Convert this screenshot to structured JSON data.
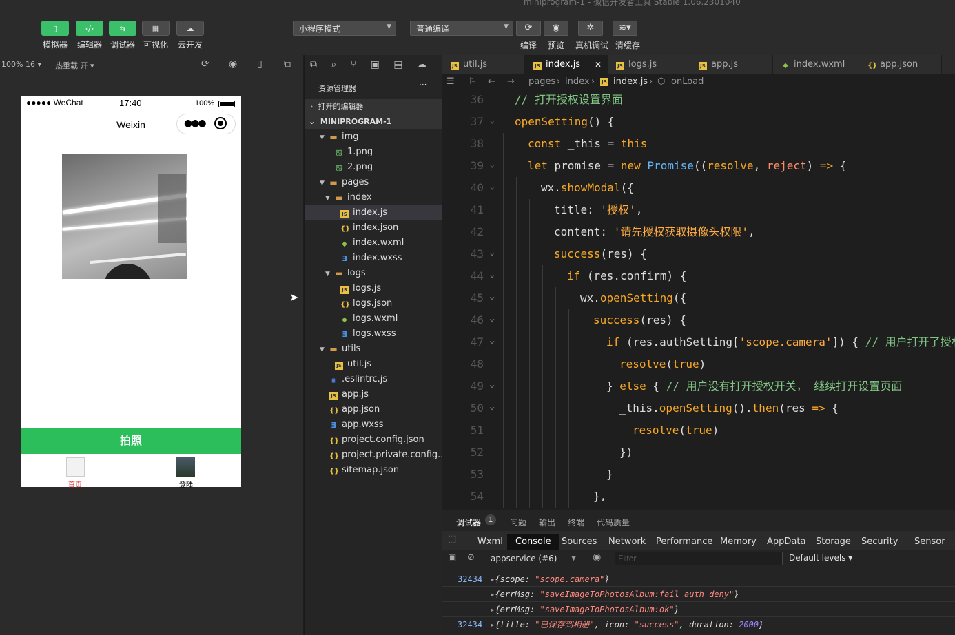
{
  "window": {
    "title": "miniprogram-1 - 微信开发者工具 Stable 1.06.2301040"
  },
  "toolbar": {
    "left_buttons": [
      {
        "label": "模拟器",
        "icon": "phone-icon"
      },
      {
        "label": "编辑器",
        "icon": "code-icon"
      },
      {
        "label": "调试器",
        "icon": "debug-icon"
      },
      {
        "label": "可视化",
        "icon": "layout-icon"
      },
      {
        "label": "云开发",
        "icon": "cloud-icon"
      }
    ],
    "mode_select": "小程序模式",
    "compile_select": "普通编译",
    "right_buttons": [
      {
        "label": "编译",
        "icon": "refresh-icon"
      },
      {
        "label": "预览",
        "icon": "eye-icon"
      },
      {
        "label": "真机调试",
        "icon": "bug-icon"
      },
      {
        "label": "清缓存",
        "icon": "layers-icon"
      }
    ]
  },
  "simulator": {
    "zoom": "100% 16",
    "hot_reload": "热重载 开",
    "status_carrier": "●●●●● WeChat",
    "status_time": "17:40",
    "status_battery": "100%",
    "nav_title": "Weixin",
    "photo_button": "拍照",
    "tabbar": [
      {
        "label": "首页",
        "active": true
      },
      {
        "label": "登陆",
        "active": false
      }
    ]
  },
  "explorer": {
    "title": "资源管理器",
    "more": "···",
    "open_editors": "打开的编辑器",
    "project": "MINIPROGRAM-1",
    "items": [
      {
        "name": "img",
        "type": "folder",
        "depth": 1,
        "open": true
      },
      {
        "name": "1.png",
        "type": "img",
        "depth": 2
      },
      {
        "name": "2.png",
        "type": "img",
        "depth": 2
      },
      {
        "name": "pages",
        "type": "folder",
        "depth": 1,
        "open": true
      },
      {
        "name": "index",
        "type": "folder",
        "depth": 2,
        "open": true
      },
      {
        "name": "index.js",
        "type": "js",
        "depth": 3,
        "selected": true
      },
      {
        "name": "index.json",
        "type": "json",
        "depth": 3
      },
      {
        "name": "index.wxml",
        "type": "wxml",
        "depth": 3
      },
      {
        "name": "index.wxss",
        "type": "wxss",
        "depth": 3
      },
      {
        "name": "logs",
        "type": "folder",
        "depth": 2,
        "open": true
      },
      {
        "name": "logs.js",
        "type": "js",
        "depth": 3
      },
      {
        "name": "logs.json",
        "type": "json",
        "depth": 3
      },
      {
        "name": "logs.wxml",
        "type": "wxml",
        "depth": 3
      },
      {
        "name": "logs.wxss",
        "type": "wxss",
        "depth": 3
      },
      {
        "name": "utils",
        "type": "folder",
        "depth": 1,
        "open": true
      },
      {
        "name": "util.js",
        "type": "js",
        "depth": 2
      },
      {
        "name": ".eslintrc.js",
        "type": "eslint",
        "depth": 1
      },
      {
        "name": "app.js",
        "type": "js",
        "depth": 1
      },
      {
        "name": "app.json",
        "type": "json",
        "depth": 1
      },
      {
        "name": "app.wxss",
        "type": "wxss",
        "depth": 1
      },
      {
        "name": "project.config.json",
        "type": "json",
        "depth": 1
      },
      {
        "name": "project.private.config...",
        "type": "json",
        "depth": 1
      },
      {
        "name": "sitemap.json",
        "type": "json",
        "depth": 1
      }
    ]
  },
  "editor": {
    "tabs": [
      {
        "name": "util.js",
        "type": "js"
      },
      {
        "name": "index.js",
        "type": "js",
        "active": true
      },
      {
        "name": "logs.js",
        "type": "js"
      },
      {
        "name": "app.js",
        "type": "js"
      },
      {
        "name": "index.wxml",
        "type": "wxml"
      },
      {
        "name": "app.json",
        "type": "json"
      }
    ],
    "breadcrumb": [
      "pages",
      "index",
      "index.js",
      "onLoad"
    ],
    "lines": [
      {
        "n": "36",
        "fold": false,
        "indent": 0,
        "text": "// 打开授权设置界面"
      },
      {
        "n": "37",
        "fold": true,
        "indent": 0,
        "text": "openSetting() {"
      },
      {
        "n": "38",
        "fold": false,
        "indent": 1,
        "text": "const _this = this"
      },
      {
        "n": "39",
        "fold": true,
        "indent": 1,
        "text": "let promise = new Promise((resolve, reject) => {"
      },
      {
        "n": "40",
        "fold": true,
        "indent": 2,
        "text": "wx.showModal({"
      },
      {
        "n": "41",
        "fold": false,
        "indent": 3,
        "text": "title: '授权',"
      },
      {
        "n": "42",
        "fold": false,
        "indent": 3,
        "text": "content: '请先授权获取摄像头权限',"
      },
      {
        "n": "43",
        "fold": true,
        "indent": 3,
        "text": "success(res) {"
      },
      {
        "n": "44",
        "fold": true,
        "indent": 4,
        "text": "if (res.confirm) {"
      },
      {
        "n": "45",
        "fold": true,
        "indent": 5,
        "text": "wx.openSetting({"
      },
      {
        "n": "46",
        "fold": true,
        "indent": 6,
        "text": "success(res) {"
      },
      {
        "n": "47",
        "fold": true,
        "indent": 7,
        "text": "if (res.authSetting['scope.camera']) { // 用户打开了授权"
      },
      {
        "n": "48",
        "fold": false,
        "indent": 8,
        "text": "resolve(true)"
      },
      {
        "n": "49",
        "fold": true,
        "indent": 7,
        "text": "} else { // 用户没有打开授权开关， 继续打开设置页面"
      },
      {
        "n": "50",
        "fold": true,
        "indent": 8,
        "text": "_this.openSetting().then(res => {"
      },
      {
        "n": "51",
        "fold": false,
        "indent": 9,
        "text": "resolve(true)"
      },
      {
        "n": "52",
        "fold": false,
        "indent": 8,
        "text": "})"
      },
      {
        "n": "53",
        "fold": false,
        "indent": 7,
        "text": "}"
      },
      {
        "n": "54",
        "fold": false,
        "indent": 6,
        "text": "},"
      }
    ]
  },
  "devtools": {
    "top_tabs": [
      "调试器",
      "问题",
      "输出",
      "终端",
      "代码质量"
    ],
    "badge": "1",
    "tabs": [
      "Wxml",
      "Console",
      "Sources",
      "Network",
      "Performance",
      "Memory",
      "AppData",
      "Storage",
      "Security",
      "Sensor"
    ],
    "active_tab": "Console",
    "context": "appservice (#6)",
    "filter_placeholder": "Filter",
    "levels": "Default levels",
    "logs": [
      {
        "num": "32434",
        "text": "{scope: \"scope.camera\"}"
      },
      {
        "num": "",
        "text": "{errMsg: \"saveImageToPhotosAlbum:fail auth deny\"}"
      },
      {
        "num": "",
        "text": "{errMsg: \"saveImageToPhotosAlbum:ok\"}"
      },
      {
        "num": "32434",
        "text": "{title: \"已保存到相册\", icon: \"success\", duration: 2000}"
      }
    ]
  }
}
